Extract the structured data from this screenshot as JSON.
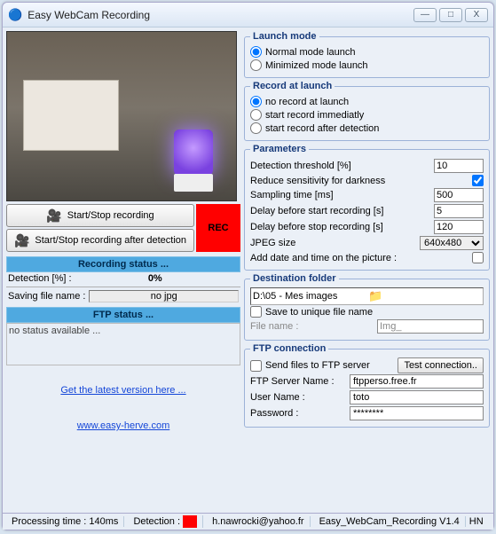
{
  "window": {
    "title": "Easy WebCam Recording",
    "min": "—",
    "max": "□",
    "close": "X"
  },
  "left": {
    "btn_start": "Start/Stop recording",
    "btn_start_det": "Start/Stop recording after detection",
    "rec": "REC",
    "sec_recording": "Recording status ...",
    "detection_label": "Detection [%] :",
    "detection_value": "0%",
    "saving_label": "Saving file name :",
    "saving_value": "no jpg",
    "sec_ftp": "FTP status ...",
    "ftp_status": "no status available ...",
    "link_latest": "Get the latest version here ...",
    "link_site": "www.easy-herve.com"
  },
  "launch": {
    "legend": "Launch mode",
    "opt_normal": "Normal mode launch",
    "opt_min": "Minimized mode launch",
    "selected": "normal"
  },
  "record_launch": {
    "legend": "Record at launch",
    "opt_none": "no record at launch",
    "opt_immed": "start record immediatly",
    "opt_after": "start record after detection",
    "selected": "none"
  },
  "params": {
    "legend": "Parameters",
    "threshold_label": "Detection threshold [%]",
    "threshold": "10",
    "reduce_label": "Reduce sensitivity for darkness",
    "reduce": true,
    "sampling_label": "Sampling time [ms]",
    "sampling": "500",
    "delay_before_label": "Delay before start recording [s]",
    "delay_before": "5",
    "delay_stop_label": "Delay before stop recording [s]",
    "delay_stop": "120",
    "jpeg_label": "JPEG size",
    "jpeg": "640x480",
    "adddate_label": "Add date and time on the picture :",
    "adddate": false
  },
  "dest": {
    "legend": "Destination folder",
    "path": "D:\\05 - Mes images",
    "save_unique_label": "Save to unique file name",
    "save_unique": false,
    "filename_label": "File name :",
    "filename": "Img_"
  },
  "ftp": {
    "legend": "FTP connection",
    "send_label": "Send files to FTP server",
    "send": false,
    "test_label": "Test connection..",
    "server_label": "FTP Server Name :",
    "server": "ftpperso.free.fr",
    "user_label": "User Name :",
    "user": "toto",
    "pass_label": "Password :",
    "pass": "********"
  },
  "status": {
    "proc": "Processing time : 140ms",
    "det": "Detection :",
    "email": "h.nawrocki@yahoo.fr",
    "ver": "Easy_WebCam_Recording V1.4",
    "author": "HN"
  }
}
